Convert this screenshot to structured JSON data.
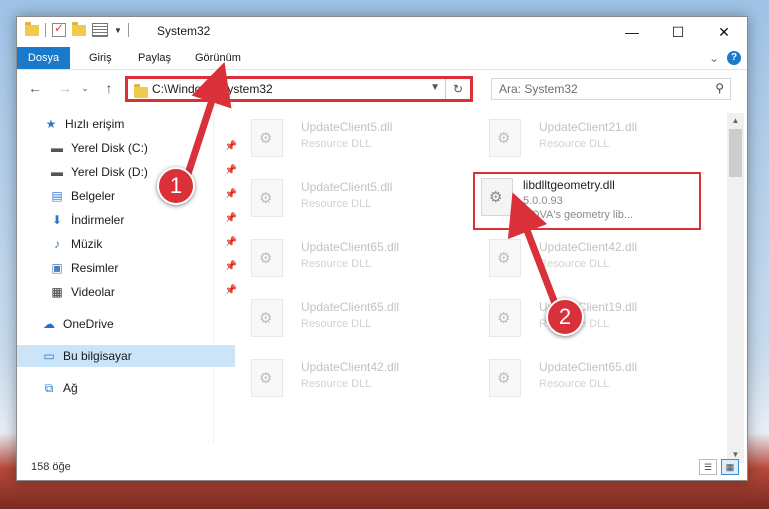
{
  "window": {
    "title": "System32",
    "controls": {
      "minimize": "—",
      "maximize": "☐",
      "close": "✕"
    }
  },
  "ribbon": {
    "tabs": [
      "Dosya",
      "Giriş",
      "Paylaş",
      "Görünüm"
    ]
  },
  "address": {
    "path": "C:\\Windows\\System32",
    "search_placeholder": "Ara: System32"
  },
  "sidebar": {
    "items": [
      {
        "label": "Hızlı erişim",
        "icon": "star-icon"
      },
      {
        "label": "Yerel Disk (C:)",
        "icon": "drive-icon",
        "pinned": true
      },
      {
        "label": "Yerel Disk (D:)",
        "icon": "drive-icon",
        "pinned": true
      },
      {
        "label": "Belgeler",
        "icon": "documents-icon",
        "pinned": true
      },
      {
        "label": "İndirmeler",
        "icon": "download-icon",
        "pinned": true
      },
      {
        "label": "Müzik",
        "icon": "music-icon",
        "pinned": true
      },
      {
        "label": "Resimler",
        "icon": "pictures-icon",
        "pinned": true
      },
      {
        "label": "Videolar",
        "icon": "videos-icon",
        "pinned": true
      },
      {
        "label": "OneDrive",
        "icon": "cloud-icon"
      },
      {
        "label": "Bu bilgisayar",
        "icon": "computer-icon",
        "selected": true
      },
      {
        "label": "Ağ",
        "icon": "network-icon"
      }
    ]
  },
  "files": [
    {
      "name": "UpdateClient5.dll",
      "desc": "Resource DLL"
    },
    {
      "name": "UpdateClient21.dll",
      "desc": "Resource DLL"
    },
    {
      "name": "UpdateClient5.dll",
      "desc": "Resource DLL"
    },
    {
      "name": "libdlltgeometry.dll",
      "version": "5.0.0.93",
      "desc": "NOVA's geometry lib...",
      "highlighted": true
    },
    {
      "name": "UpdateClient65.dll",
      "desc": "Resource DLL"
    },
    {
      "name": "UpdateClient42.dll",
      "desc": "Resource DLL"
    },
    {
      "name": "UpdateClient65.dll",
      "desc": "Resource DLL"
    },
    {
      "name": "UpdateClient19.dll",
      "desc": "Resource DLL"
    },
    {
      "name": "UpdateClient42.dll",
      "desc": "Resource DLL"
    },
    {
      "name": "UpdateClient65.dll",
      "desc": "Resource DLL"
    }
  ],
  "status": {
    "count": "158 öğe"
  },
  "annotations": {
    "marker1": "1",
    "marker2": "2",
    "accent": "#d9303a"
  }
}
